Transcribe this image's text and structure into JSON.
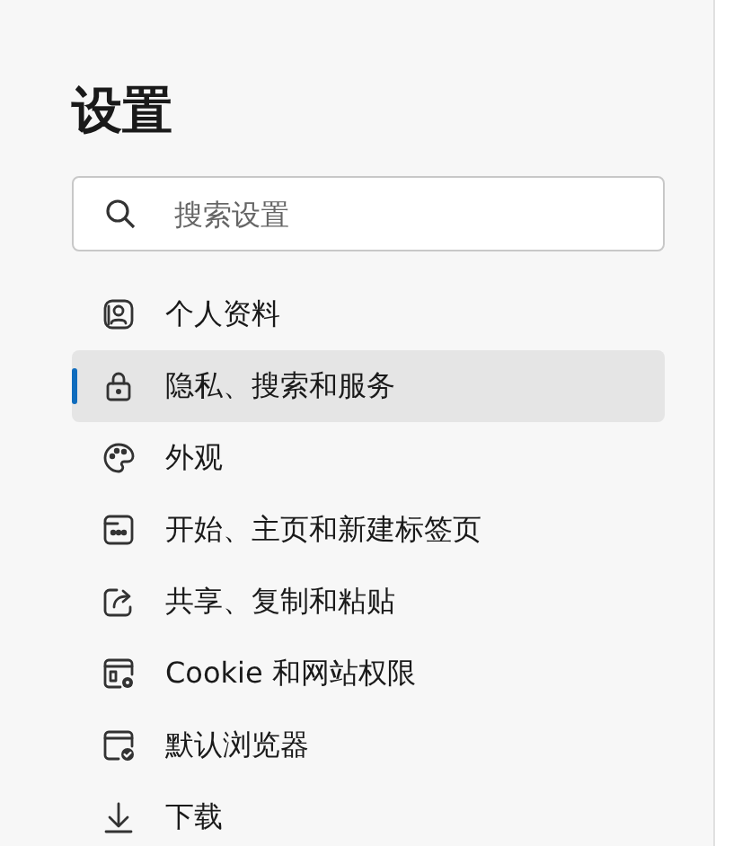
{
  "title": "设置",
  "search": {
    "placeholder": "搜索设置"
  },
  "nav": [
    {
      "kind": "profile",
      "label": "个人资料",
      "selected": false
    },
    {
      "kind": "lock",
      "label": "隐私、搜索和服务",
      "selected": true
    },
    {
      "kind": "palette",
      "label": "外观",
      "selected": false
    },
    {
      "kind": "newtab",
      "label": "开始、主页和新建标签页",
      "selected": false
    },
    {
      "kind": "share",
      "label": "共享、复制和粘贴",
      "selected": false
    },
    {
      "kind": "cookie",
      "label": "Cookie 和网站权限",
      "selected": false
    },
    {
      "kind": "browser",
      "label": "默认浏览器",
      "selected": false
    },
    {
      "kind": "download",
      "label": "下载",
      "selected": false
    }
  ]
}
